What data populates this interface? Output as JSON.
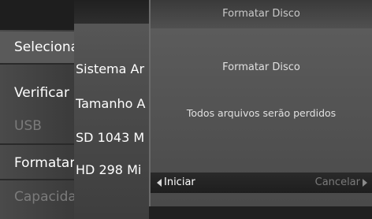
{
  "menu": {
    "items": [
      {
        "label": "Selecionar",
        "state": "selected"
      },
      {
        "label": "Verificar",
        "state": "normal"
      },
      {
        "label": "USB",
        "state": "disabled"
      },
      {
        "label": "Formatar",
        "state": "normal"
      },
      {
        "label": "Capacidade",
        "state": "disabled"
      }
    ]
  },
  "info": {
    "lines": [
      "Sistema Ar",
      "Tamanho A",
      "SD 1043 M",
      "HD 298 Mi"
    ]
  },
  "dialog": {
    "title": "Formatar Disco",
    "heading": "Formatar Disco",
    "message": "Todos arquivos serão perdidos",
    "start_label": "Iniciar",
    "cancel_label": "Cancelar"
  },
  "colors": {
    "background": "#1c1c1c",
    "dialog_bg": "#545454",
    "footer_bg": "#1e1e1e",
    "text": "#ffffff",
    "disabled_text": "#7b7b7b"
  }
}
